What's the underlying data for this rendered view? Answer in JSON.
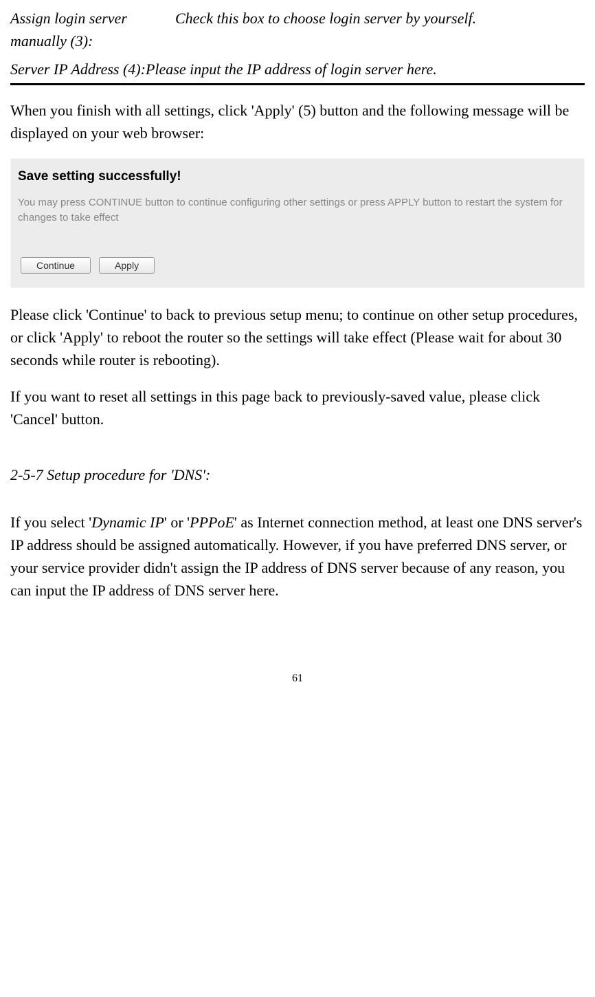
{
  "settings": {
    "row3": {
      "label": "Assign login server manually (3):",
      "desc": "Check this box to choose login server by yourself."
    },
    "row4": {
      "label": "Server IP Address (4):",
      "desc": "Please input the IP address of login server here."
    }
  },
  "paragraphs": {
    "p1": "When you finish with all settings, click 'Apply' (5) button and the following message will be displayed on your web browser:",
    "p2": "Please click 'Continue' to back to previous setup menu; to continue on other setup procedures, or click 'Apply' to reboot the router so the settings will take effect (Please wait for about 30 seconds while router is rebooting).",
    "p3": "If you want to reset all settings in this page back to previously-saved value, please click 'Cancel' button.",
    "p4_prefix": "If you select '",
    "p4_em1": "Dynamic IP",
    "p4_mid1": "' or '",
    "p4_em2": "PPPoE",
    "p4_suffix": "' as Internet connection method, at least one DNS server's IP address should be assigned automatically. However, if you have preferred DNS server, or your service provider didn't assign the IP address of DNS server because of any reason, you can input the IP address of DNS server here."
  },
  "dialog": {
    "title": "Save setting successfully!",
    "subtext": "You may press CONTINUE button to continue configuring other settings or press APPLY button to restart the system for changes to take effect",
    "btn_continue": "Continue",
    "btn_apply": "Apply"
  },
  "heading": "2-5-7 Setup procedure for 'DNS':",
  "page_number": "61"
}
